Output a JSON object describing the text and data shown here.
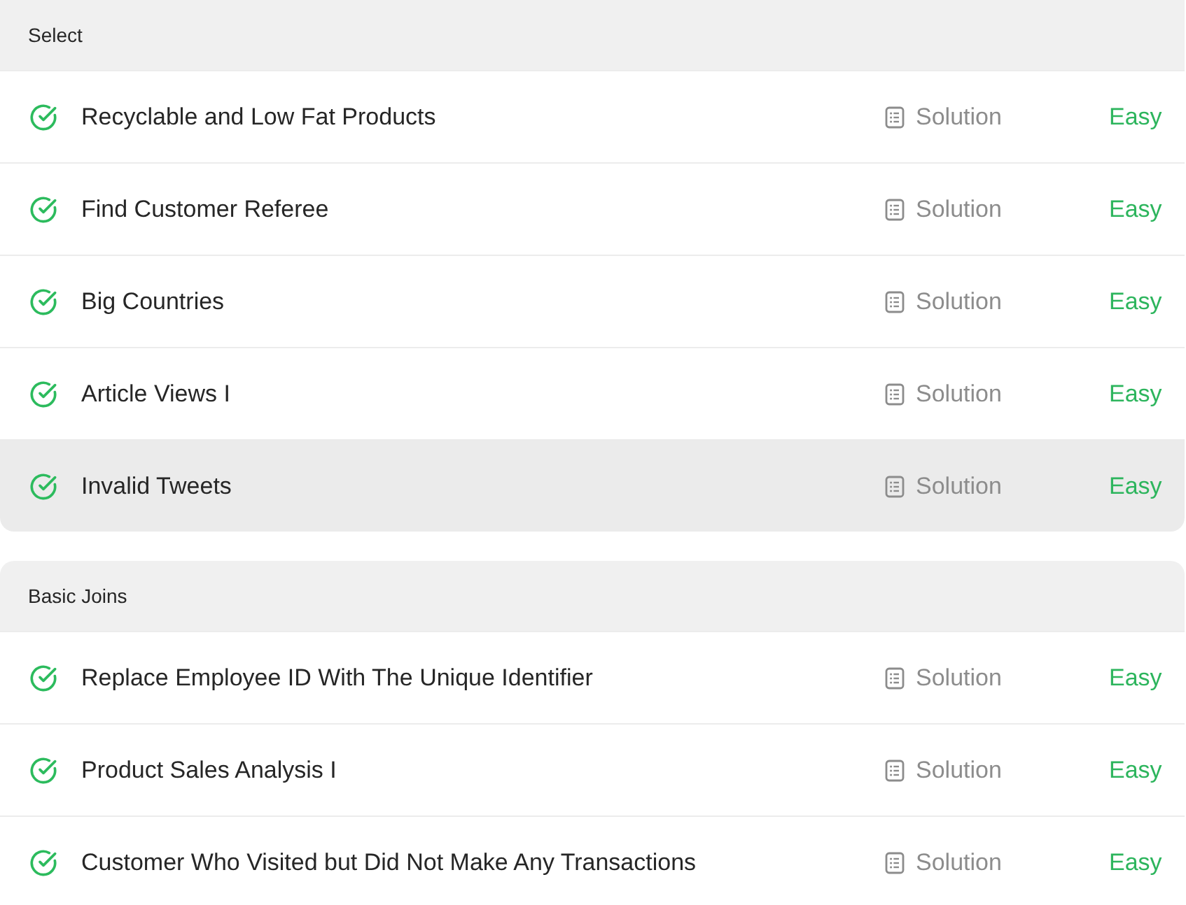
{
  "sections": [
    {
      "title": "Select",
      "problems": [
        {
          "title": "Recyclable and Low Fat Products",
          "solved": true,
          "highlighted": false,
          "solution": "Solution",
          "difficulty": "Easy"
        },
        {
          "title": "Find Customer Referee",
          "solved": true,
          "highlighted": false,
          "solution": "Solution",
          "difficulty": "Easy"
        },
        {
          "title": "Big Countries",
          "solved": true,
          "highlighted": false,
          "solution": "Solution",
          "difficulty": "Easy"
        },
        {
          "title": "Article Views I",
          "solved": true,
          "highlighted": false,
          "solution": "Solution",
          "difficulty": "Easy"
        },
        {
          "title": "Invalid Tweets",
          "solved": true,
          "highlighted": true,
          "solution": "Solution",
          "difficulty": "Easy"
        }
      ]
    },
    {
      "title": "Basic Joins",
      "problems": [
        {
          "title": "Replace Employee ID With The Unique Identifier",
          "solved": true,
          "highlighted": false,
          "solution": "Solution",
          "difficulty": "Easy"
        },
        {
          "title": "Product Sales Analysis I",
          "solved": true,
          "highlighted": false,
          "solution": "Solution",
          "difficulty": "Easy"
        },
        {
          "title": "Customer Who Visited but Did Not Make Any Transactions",
          "solved": true,
          "highlighted": false,
          "solution": "Solution",
          "difficulty": "Easy"
        }
      ]
    }
  ]
}
